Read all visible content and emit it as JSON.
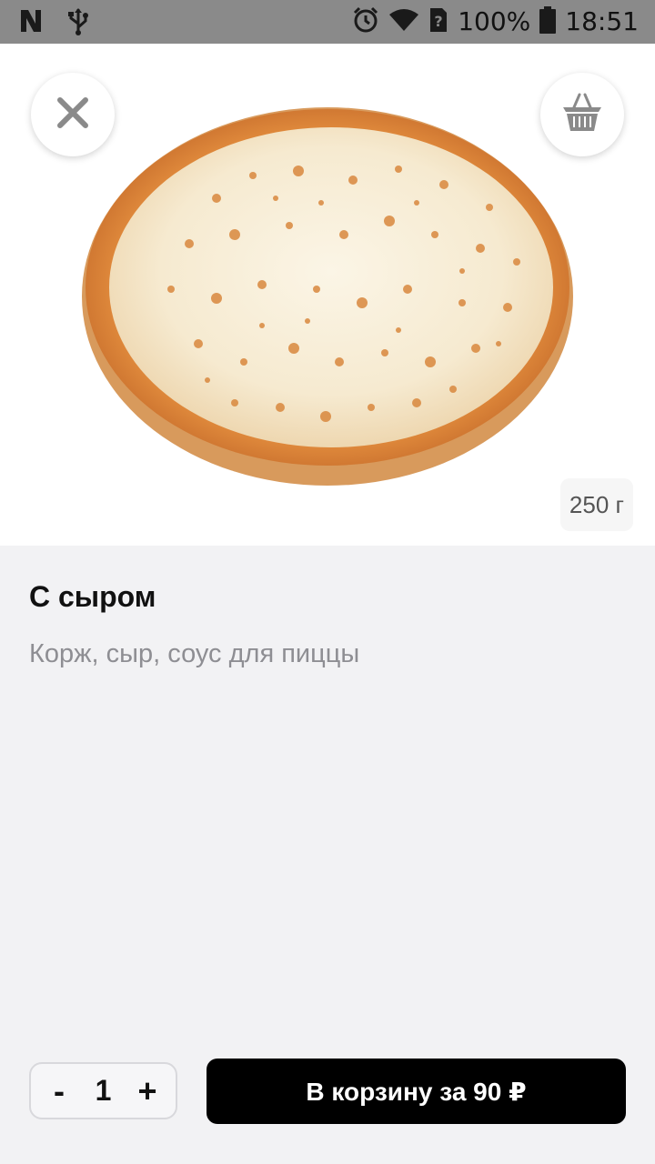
{
  "status_bar": {
    "battery_percent": "100%",
    "time": "18:51",
    "icons": [
      "notification-n-icon",
      "usb-icon",
      "alarm-icon",
      "wifi-icon",
      "sim-unknown-icon",
      "battery-icon"
    ]
  },
  "product": {
    "title": "С сыром",
    "description": "Корж, сыр, соус для пиццы",
    "weight": "250 г"
  },
  "actions": {
    "decrement_label": "-",
    "quantity": "1",
    "increment_label": "+",
    "add_to_cart_label": "В корзину за 90 ₽"
  },
  "colors": {
    "background": "#f2f2f4",
    "button": "#000000",
    "status_bar": "#8a8a8a"
  }
}
